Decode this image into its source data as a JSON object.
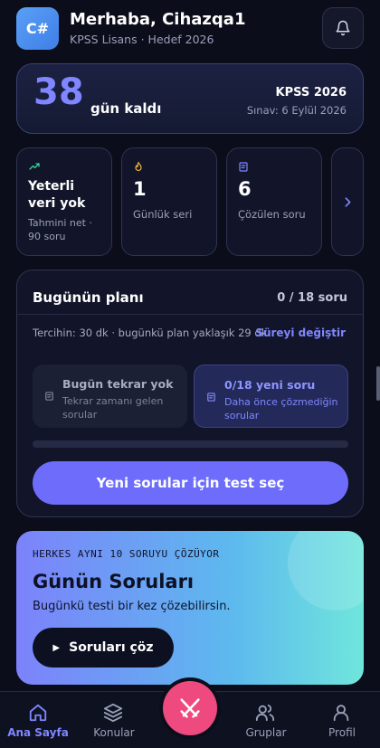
{
  "header": {
    "avatar_text": "C#",
    "greeting": "Merhaba, Cihazqa1",
    "subtitle": "KPSS Lisans · Hedef 2026",
    "notification_icon": "bell-icon"
  },
  "countdown": {
    "days": "38",
    "days_label": "gün kaldı",
    "exam": "KPSS 2026",
    "exam_date": "Sınav: 6 Eylül 2026"
  },
  "stats": [
    {
      "icon": "trend-up-icon",
      "title": "Yeterli veri yok",
      "subtitle": "Tahmini net · 90 soru",
      "color": "#36d39a"
    },
    {
      "icon": "flame-icon",
      "value": "1",
      "label": "Günlük seri",
      "color": "#f2b533"
    },
    {
      "icon": "document-icon",
      "value": "6",
      "label": "Çözülen soru",
      "color": "#7f86ff"
    }
  ],
  "plan": {
    "title": "Bugünün planı",
    "count": "0 / 18 soru",
    "preference": "Tercihin: 30 dk · bugünkü plan yaklaşık 29 dk",
    "change_link": "Süreyi değiştir",
    "review_tile": {
      "title": "Bugün tekrar yok",
      "subtitle": "Tekrar zamanı gelen sorular"
    },
    "new_tile": {
      "title": "0/18 yeni soru",
      "subtitle": "Daha önce çözmediğin sorular"
    },
    "progress": 0,
    "cta": "Yeni sorular için test seç"
  },
  "daily": {
    "kicker": "HERKES AYNI 10 SORUYU ÇÖZÜYOR",
    "title": "Günün Soruları",
    "subtitle": "Bugünkü testi bir kez çözebilirsin.",
    "button": "Soruları çöz"
  },
  "nav": {
    "home": "Ana Sayfa",
    "topics": "Konular",
    "groups": "Gruplar",
    "profile": "Profil"
  },
  "colors": {
    "accent": "#7f86ff",
    "fab": "#ee4a7f",
    "background": "#0b0d1a"
  }
}
